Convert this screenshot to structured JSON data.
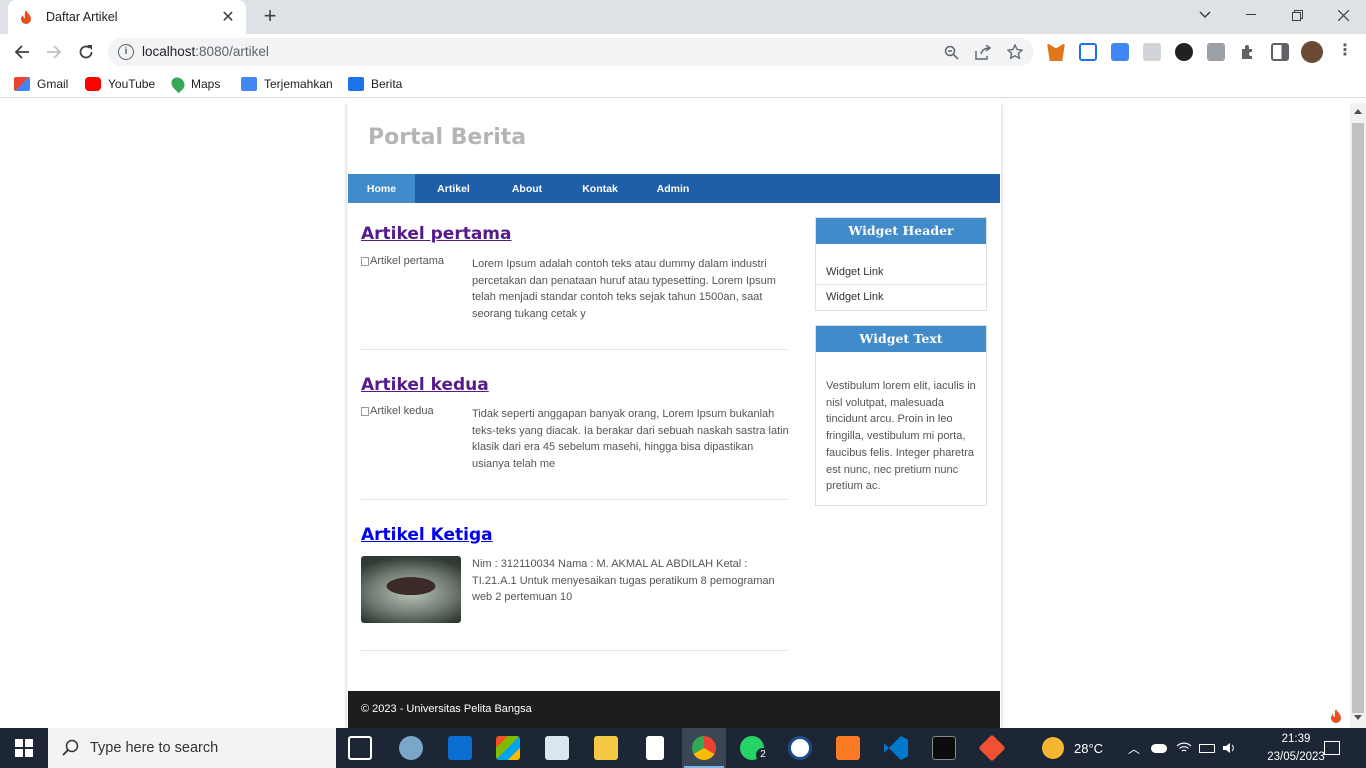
{
  "browser": {
    "tab_title": "Daftar Artikel",
    "url_host": "localhost",
    "url_rest": ":8080/artikel",
    "bookmarks": [
      {
        "label": "Gmail",
        "color": "#ea4335"
      },
      {
        "label": "YouTube",
        "color": "#ff0000"
      },
      {
        "label": "Maps",
        "color": "#34a853"
      },
      {
        "label": "Terjemahkan",
        "color": "#4285f4"
      },
      {
        "label": "Berita",
        "color": "#1a73e8"
      }
    ]
  },
  "site": {
    "title": "Portal Berita",
    "nav": [
      "Home",
      "Artikel",
      "About",
      "Kontak",
      "Admin"
    ],
    "active_nav": "Home",
    "accent": "#428bca",
    "nav_bg": "#1f5faa"
  },
  "articles": [
    {
      "title": "Artikel pertama",
      "img_alt": "Artikel pertama",
      "excerpt": "Lorem Ipsum adalah contoh teks atau dummy dalam industri percetakan dan penataan huruf atau typesetting. Lorem Ipsum telah menjadi standar contoh teks sejak tahun 1500an, saat seorang tukang cetak y",
      "visited": true
    },
    {
      "title": "Artikel kedua",
      "img_alt": "Artikel kedua",
      "excerpt": "Tidak seperti anggapan banyak orang, Lorem Ipsum bukanlah teks-teks yang diacak. Ia berakar dari sebuah naskah sastra latin klasik dari era 45 sebelum masehi, hingga bisa dipastikan usianya telah me",
      "visited": true
    },
    {
      "title": "Artikel Ketiga",
      "img_alt": "",
      "excerpt": "Nim : 312110034 Nama : M. AKMAL AL ABDILAH Ketal : TI.21.A.1 Untuk menyesaikan tugas peratikum 8 pemograman web 2 pertemuan 10",
      "visited": false
    }
  ],
  "sidebar": {
    "widget1": {
      "header": "Widget Header",
      "links": [
        "Widget Link",
        "Widget Link"
      ]
    },
    "widget2": {
      "header": "Widget Text",
      "text": "Vestibulum lorem elit, iaculis in nisl volutpat, malesuada tincidunt arcu. Proin in leo fringilla, vestibulum mi porta, faucibus felis. Integer pharetra est nunc, nec pretium nunc pretium ac."
    }
  },
  "footer": "© 2023 - Universitas Pelita Bangsa",
  "taskbar": {
    "search_placeholder": "Type here to search",
    "whatsapp_badge": "2",
    "weather": "28°C",
    "time": "21:39",
    "date": "23/05/2023"
  }
}
